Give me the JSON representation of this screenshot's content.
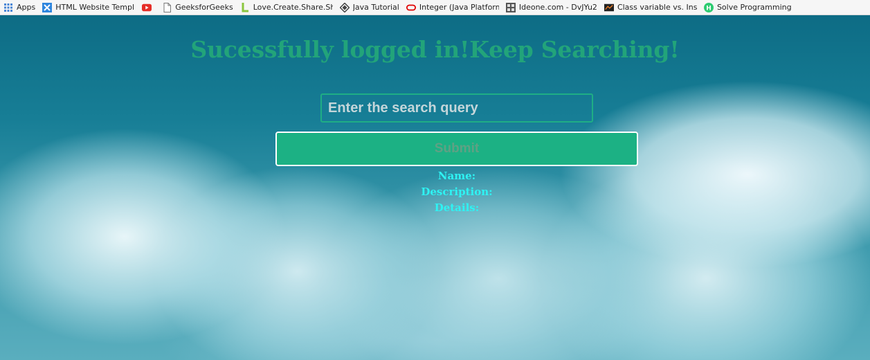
{
  "bookmarks": [
    {
      "label": "Apps",
      "icon": "apps-grid-icon"
    },
    {
      "label": "HTML Website Templ",
      "icon": "template-icon"
    },
    {
      "label": "",
      "icon": "youtube-icon"
    },
    {
      "label": "GeeksforGeeks",
      "icon": "page-icon"
    },
    {
      "label": "Love.Create.Share.Sho",
      "icon": "lcs-logo-icon"
    },
    {
      "label": "Java Tutorial",
      "icon": "java-tutorial-icon"
    },
    {
      "label": "Integer (Java Platform",
      "icon": "oracle-icon"
    },
    {
      "label": "Ideone.com - DvJYu2",
      "icon": "ideone-icon"
    },
    {
      "label": "Class variable vs. Insta",
      "icon": "stackoverflow-icon"
    },
    {
      "label": "Solve Programming C",
      "icon": "hackerearth-icon"
    }
  ],
  "page": {
    "heading": "Sucessfully logged in!Keep Searching!",
    "search_placeholder": "Enter the search query",
    "submit_label": "Submit",
    "fields": {
      "name_label": "Name:",
      "description_label": "Description:",
      "details_label": "Details:"
    }
  },
  "colors": {
    "heading": "#22a47a",
    "button": "#1cb184",
    "labels": "#2ef3f3"
  }
}
